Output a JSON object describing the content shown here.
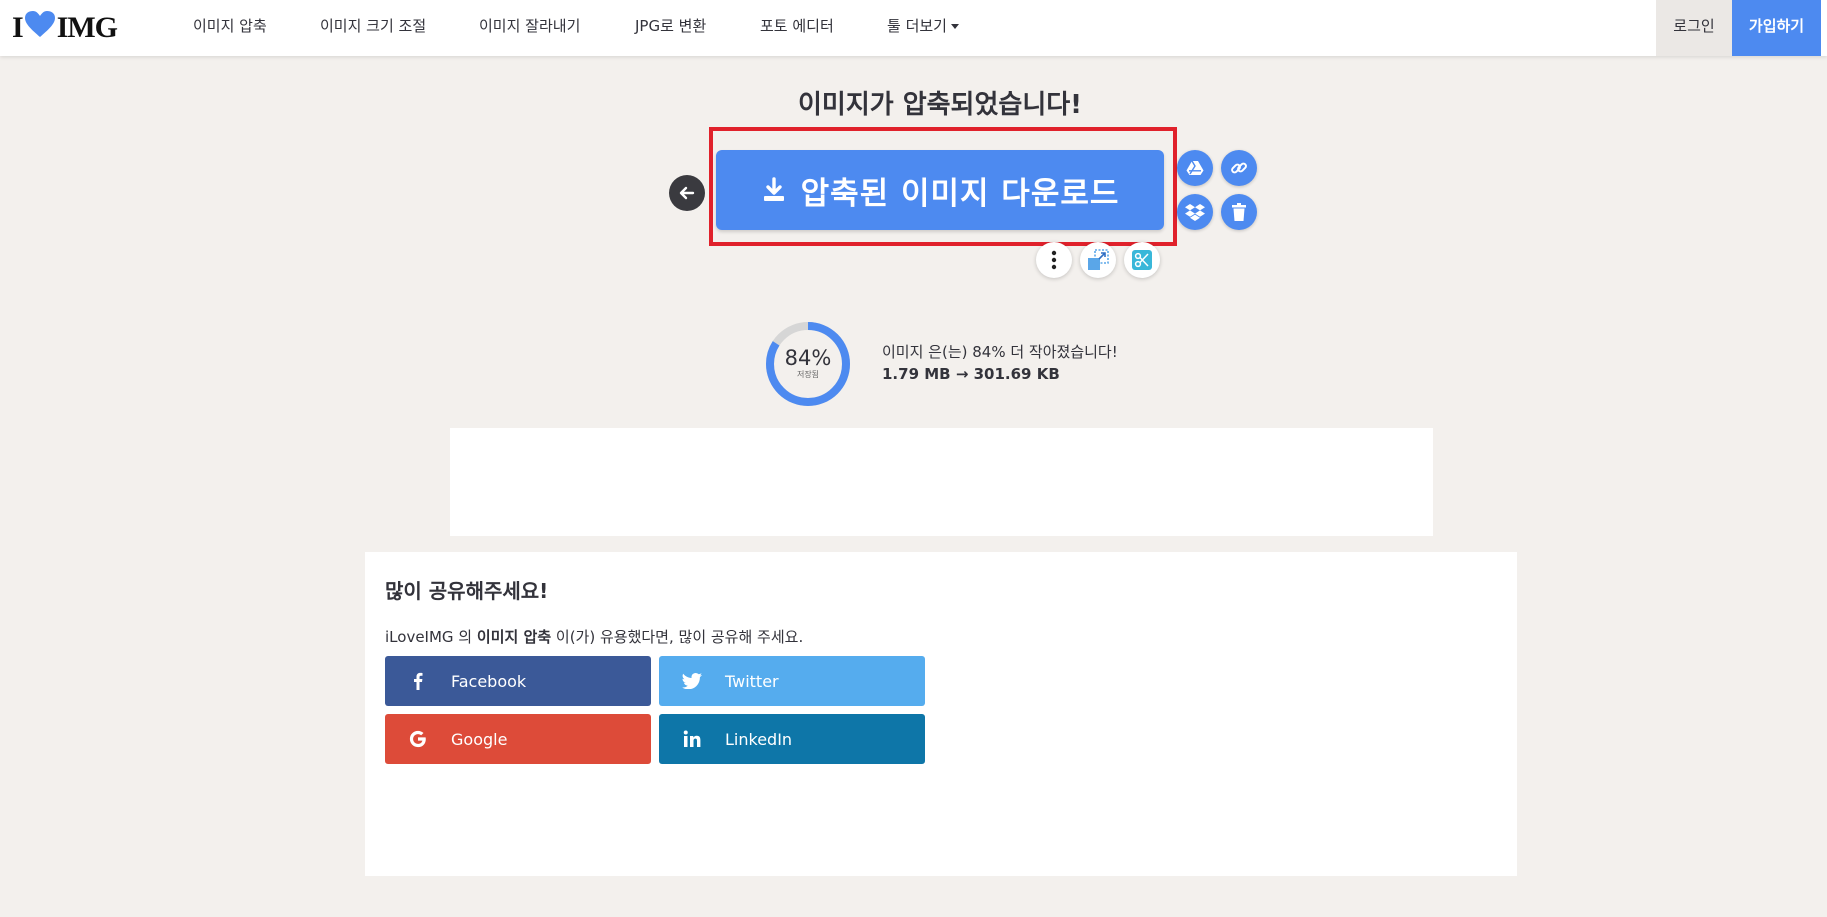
{
  "header": {
    "logo": {
      "left": "I",
      "right": "IMG",
      "heart_color": "#4d8af0"
    },
    "nav": [
      {
        "label": "이미지 압축"
      },
      {
        "label": "이미지 크기 조절"
      },
      {
        "label": "이미지 잘라내기"
      },
      {
        "label": "JPG로 변환"
      },
      {
        "label": "포토 에디터"
      },
      {
        "label": "툴 더보기"
      }
    ],
    "login": "로그인",
    "signup": "가입하기"
  },
  "main": {
    "title": "이미지가 압축되었습니다!",
    "download_label": "압축된 이미지 다운로드",
    "side_icons": [
      "google-drive-icon",
      "link-icon",
      "dropbox-icon",
      "trash-icon"
    ],
    "tool_icons": [
      "more-icon",
      "resize-icon",
      "crop-icon"
    ]
  },
  "stats": {
    "percent_saved": 84,
    "percent_label": "84%",
    "saved_label": "저장됨",
    "summary": "이미지 은(는) 84% 더 작아졌습니다!",
    "sizes": "1.79 MB → 301.69 KB"
  },
  "share": {
    "title": "많이 공유해주세요!",
    "desc_prefix": "iLoveIMG 의",
    "desc_tool": "이미지 압축",
    "desc_suffix": "이(가) 유용했다면, 많이 공유해 주세요.",
    "buttons": [
      {
        "label": "Facebook",
        "color": "#3b5998"
      },
      {
        "label": "Twitter",
        "color": "#55acee"
      },
      {
        "label": "Google",
        "color": "#dd4b39"
      },
      {
        "label": "LinkedIn",
        "color": "#0e76a8"
      }
    ]
  },
  "colors": {
    "accent": "#4d8af0",
    "highlight_frame": "#e0212b",
    "background": "#f3f0ed"
  }
}
